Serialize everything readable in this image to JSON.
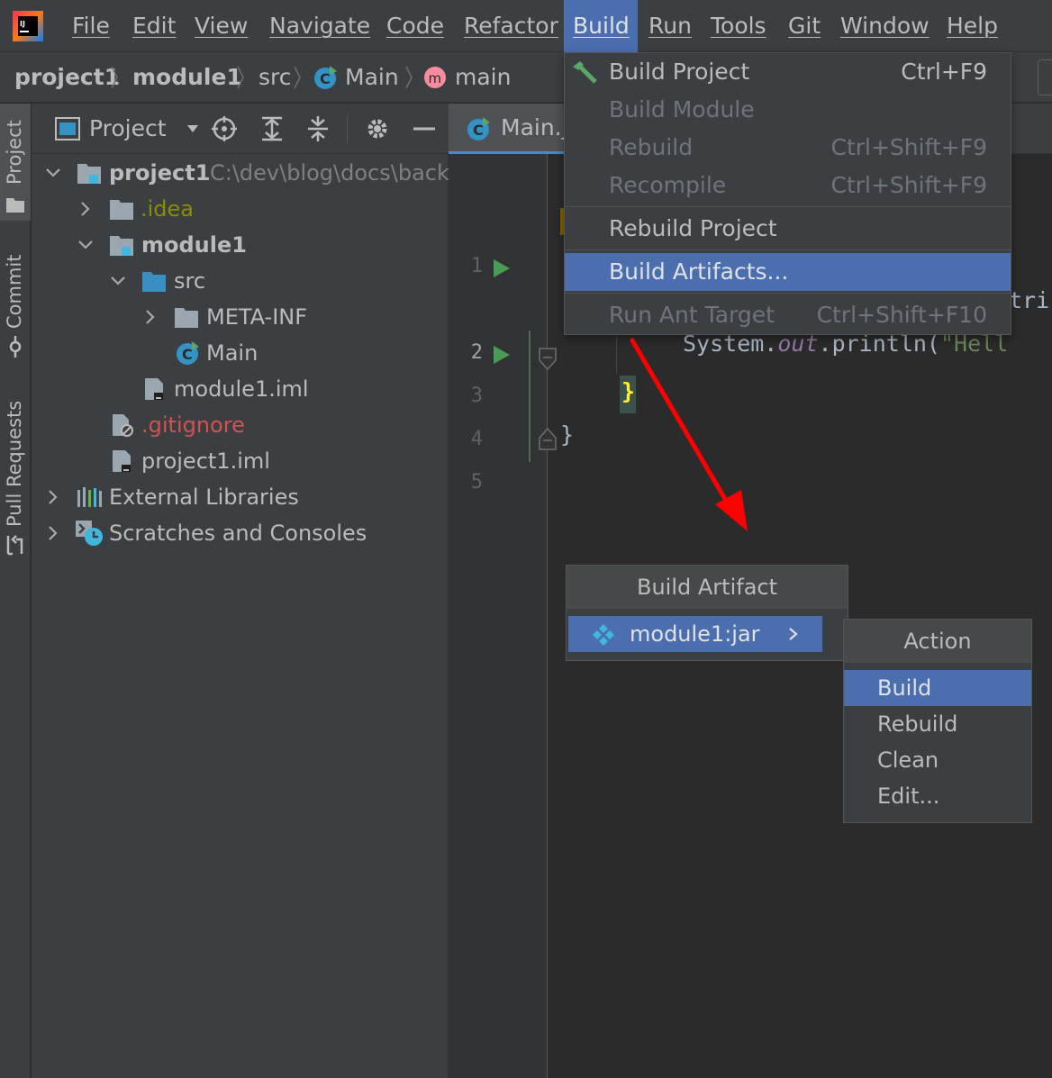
{
  "menubar": {
    "items": [
      "File",
      "Edit",
      "View",
      "Navigate",
      "Code",
      "Refactor",
      "Build",
      "Run",
      "Tools",
      "Git",
      "Window",
      "Help"
    ],
    "active": "Build"
  },
  "breadcrumb": {
    "items": [
      "project1",
      "module1",
      "src",
      "Main",
      "main"
    ]
  },
  "toolstripe": {
    "tabs": [
      "Project",
      "Commit",
      "Pull Requests"
    ]
  },
  "project_panel": {
    "title": "Project",
    "tree": [
      {
        "label": "project1",
        "hint": "C:\\dev\\blog\\docs\\back-",
        "bold": true
      },
      {
        "label": ".idea"
      },
      {
        "label": "module1",
        "bold": true
      },
      {
        "label": "src"
      },
      {
        "label": "META-INF"
      },
      {
        "label": "Main"
      },
      {
        "label": "module1.iml"
      },
      {
        "label": ".gitignore"
      },
      {
        "label": "project1.iml"
      },
      {
        "label": "External Libraries"
      },
      {
        "label": "Scratches and Consoles"
      }
    ]
  },
  "editor": {
    "tab_label": "Main.j",
    "line_numbers": [
      "1",
      "2",
      "3",
      "4",
      "5"
    ],
    "code": {
      "line2_tail": "tri",
      "line3": "System.out.println(\"Hell",
      "line3_parts": [
        "System.",
        "out",
        ".println(",
        "\"Hell"
      ],
      "line4": "}",
      "line5": "}"
    }
  },
  "build_menu": {
    "items": [
      {
        "label": "Build Project",
        "shortcut": "Ctrl+F9",
        "state": "enabled"
      },
      {
        "label": "Build Module",
        "shortcut": "",
        "state": "disabled"
      },
      {
        "label": "Rebuild",
        "shortcut": "Ctrl+Shift+F9",
        "state": "disabled"
      },
      {
        "label": "Recompile",
        "shortcut": "Ctrl+Shift+F9",
        "state": "disabled"
      },
      {
        "label": "Rebuild Project",
        "shortcut": "",
        "state": "enabled"
      },
      {
        "label": "Build Artifacts...",
        "shortcut": "",
        "state": "selected"
      },
      {
        "label": "Run Ant Target",
        "shortcut": "Ctrl+Shift+F10",
        "state": "disabled"
      }
    ]
  },
  "artifact_popup": {
    "title": "Build Artifact",
    "items": [
      "module1:jar"
    ]
  },
  "action_popup": {
    "title": "Action",
    "items": [
      "Build",
      "Rebuild",
      "Clean",
      "Edit..."
    ],
    "selected": "Build"
  },
  "colors": {
    "selection": "#4b6eaf",
    "annotation_arrow": "#ff0000",
    "gitignore_text": "#d25252",
    "idea_text": "#8c8c00"
  }
}
